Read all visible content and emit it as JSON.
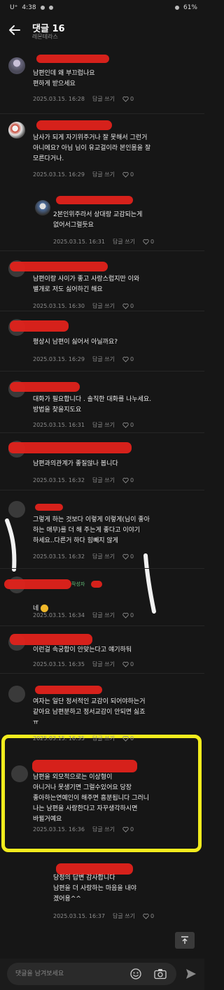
{
  "status_bar": {
    "carrier": "U⁺",
    "time": "4:38",
    "battery": "61%"
  },
  "header": {
    "title": "댓글 16",
    "subtitle": "레몬테라스"
  },
  "comments": [
    {
      "text": "남편인데 왜 부끄럽나요\n편하게 받으세요",
      "date": "2025.03.15. 16:28",
      "reply_label": "답글 쓰기",
      "likes": "0"
    },
    {
      "text": "남사가 되게 자기위주거나 잘 못해서 그런거\n아니에요? 아님 님이 유교걸이라 본인몸을 잘\n모른다거나.",
      "date": "2025.03.15. 16:29",
      "reply_label": "답글 쓰기",
      "likes": "0"
    },
    {
      "text": "2본인위주라서 상대랑 교감되는게\n없어서그럴듯요",
      "date": "2025.03.15. 16:31",
      "reply_label": "답글 쓰기",
      "likes": "0"
    },
    {
      "text": "남편이랑 사이가 좋고 사랑스럽지만 이와\n별개로 저도 싫어하긴 해요",
      "date": "2025.03.15. 16:30",
      "reply_label": "답글 쓰기",
      "likes": "0"
    },
    {
      "text": "평상시 남편이 싫어서 아닐까요?",
      "date": "2025.03.15. 16:29",
      "reply_label": "답글 쓰기",
      "likes": "0"
    },
    {
      "text": "대화가 필요합니다 . 솔직한 대화를 나누세요.\n방법을 찾을지도요",
      "date": "2025.03.15. 16:31",
      "reply_label": "답글 쓰기",
      "likes": "0"
    },
    {
      "text": "남편과의관계가 좋질않나 봅니다",
      "date": "2025.03.15. 16:32",
      "reply_label": "답글 쓰기",
      "likes": "0"
    },
    {
      "text": "그렇게 하는 것보다 이렇게 이렇게(님이 좋아\n하는 애무)를 더 해 주는게 좋다고 이야기\n하세요..다른거 하다 힘빼지 않게",
      "date": "2025.03.15. 16:32",
      "reply_label": "답글 쓰기",
      "likes": "0"
    },
    {
      "text": "네",
      "date": "2025.03.15. 16:34",
      "reply_label": "답글 쓰기",
      "likes": "0",
      "badge": "작성자"
    },
    {
      "text": "이런걸 속궁합이 안맞는다고 얘기하둬",
      "date": "2025.03.15. 16:35",
      "reply_label": "답글 쓰기",
      "likes": "0"
    },
    {
      "text": "여자는 일단 정서적인 교감이 되어야하는거\n같아요 남편분하고 정서교감이 안되면 싫죠\nㅠ",
      "date": "2025.03.15. 16:35",
      "reply_label": "답글 쓰기",
      "likes": "0"
    },
    {
      "text": "남편을 외모적으로는 이상형이\n아니거나 못생기면 그럴수있어요 당장\n좋아하는연예인이 해주면 흥분됩니다 그러니\n나는 남편을 사랑한다고 자꾸생각하시면\n바뀔거예요",
      "date": "2025.03.15. 16:36",
      "reply_label": "답글 쓰기",
      "likes": "0"
    },
    {
      "text": "당정의 답변 감사합니다\n남편을 더 사랑하는 마음을 내야\n겠어용^^",
      "date": "2025.03.15. 16:37",
      "reply_label": "답글 쓰기",
      "likes": "0"
    }
  ],
  "input": {
    "placeholder": "댓글을 남겨보세요"
  },
  "colors": {
    "background": "#161616",
    "redaction": "#e0221b",
    "highlight": "#f3ec1d"
  },
  "icons": [
    "back-arrow-icon",
    "heart-icon",
    "emoji-icon",
    "camera-icon",
    "send-icon",
    "scroll-top-icon"
  ]
}
